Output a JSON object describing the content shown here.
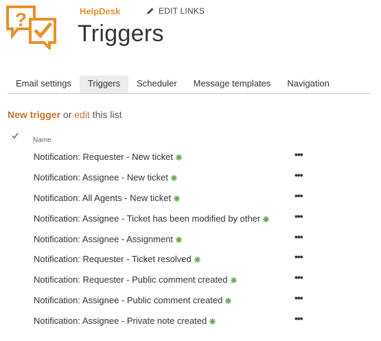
{
  "header": {
    "site_title": "HelpDesk",
    "edit_links_label": "EDIT LINKS",
    "page_title": "Triggers",
    "logo_color": "#e8902a"
  },
  "tabs": [
    {
      "label": "Email settings",
      "active": false
    },
    {
      "label": "Triggers",
      "active": true
    },
    {
      "label": "Scheduler",
      "active": false
    },
    {
      "label": "Message templates",
      "active": false
    },
    {
      "label": "Navigation",
      "active": false
    }
  ],
  "actions": {
    "new_label": "New trigger",
    "or_text": "or",
    "edit_label": "edit",
    "rest_text": "this list"
  },
  "list": {
    "column_name": "Name",
    "more_label": "•••",
    "new_badge_color": "#6aa84f",
    "items": [
      {
        "title": "Notification: Requester - New ticket"
      },
      {
        "title": "Notification: Assignee - New ticket"
      },
      {
        "title": "Notification: All Agents - New ticket"
      },
      {
        "title": "Notification: Assignee - Ticket has been modified by other"
      },
      {
        "title": "Notification: Assignee - Assignment"
      },
      {
        "title": "Notification: Requester - Ticket resolved"
      },
      {
        "title": "Notification: Requester - Public comment created"
      },
      {
        "title": "Notification: Assignee - Public comment created"
      },
      {
        "title": "Notification: Assignee - Private note created"
      }
    ]
  }
}
